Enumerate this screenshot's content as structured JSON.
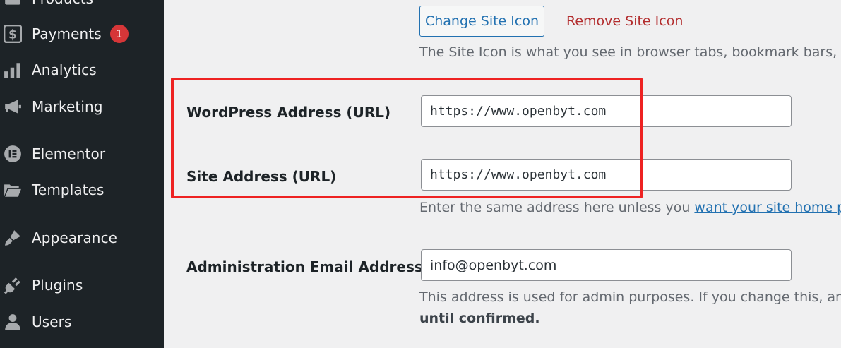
{
  "sidebar": {
    "items": [
      {
        "label": "Products",
        "icon": "products-icon"
      },
      {
        "label": "Payments",
        "icon": "payments-icon",
        "badge": "1"
      },
      {
        "label": "Analytics",
        "icon": "analytics-icon"
      },
      {
        "label": "Marketing",
        "icon": "marketing-icon"
      },
      {
        "label": "Elementor",
        "icon": "elementor-icon"
      },
      {
        "label": "Templates",
        "icon": "folder-icon"
      },
      {
        "label": "Appearance",
        "icon": "paintbrush-icon"
      },
      {
        "label": "Plugins",
        "icon": "plugin-icon"
      },
      {
        "label": "Users",
        "icon": "user-icon"
      }
    ]
  },
  "site_icon": {
    "change_label": "Change Site Icon",
    "remove_label": "Remove Site Icon",
    "description": "The Site Icon is what you see in browser tabs, bookmark bars, an"
  },
  "wordpress_address": {
    "label": "WordPress Address (URL)",
    "value": "https://www.openbyt.com"
  },
  "site_address": {
    "label": "Site Address (URL)",
    "value": "https://www.openbyt.com",
    "description_prefix": "Enter the same address here unless you ",
    "description_link": "want your site home pag"
  },
  "admin_email": {
    "label": "Administration Email Address",
    "value": "info@openbyt.com",
    "description": "This address is used for admin purposes. If you change this, an en",
    "description_strong": "until confirmed."
  },
  "colors": {
    "sidebar_bg": "#1d2327",
    "accent": "#2271b1",
    "danger": "#b32d2e",
    "badge": "#d63638",
    "highlight_box": "#ee2222"
  }
}
